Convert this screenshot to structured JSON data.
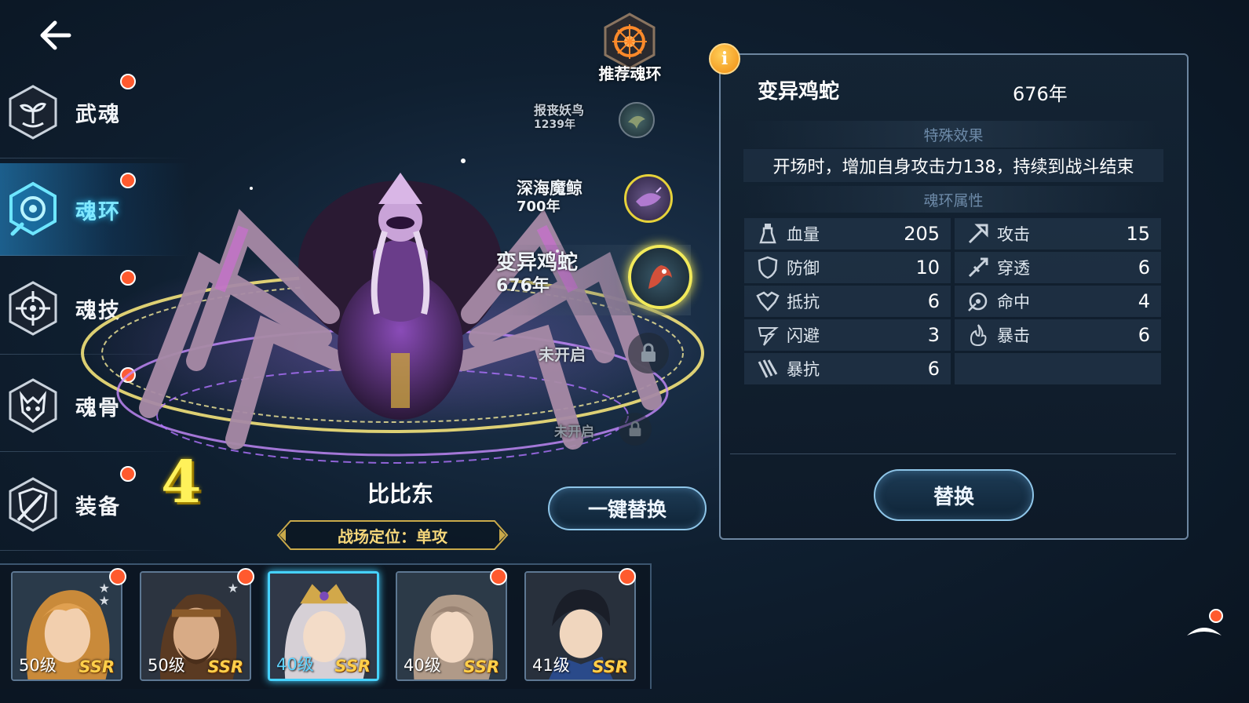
{
  "sidebar": {
    "items": [
      {
        "label": "武魂",
        "has_dot": true
      },
      {
        "label": "魂环",
        "has_dot": true,
        "active": true
      },
      {
        "label": "魂技",
        "has_dot": true
      },
      {
        "label": "魂骨",
        "has_dot": true
      },
      {
        "label": "装备",
        "has_dot": true
      }
    ]
  },
  "recommend": {
    "label": "推荐魂环"
  },
  "rings": [
    {
      "name": "报丧妖鸟",
      "years": "1239年"
    },
    {
      "name": "深海魔鲸",
      "years": "700年"
    },
    {
      "name": "变异鸡蛇",
      "years": "676年"
    },
    {
      "name": "未开启",
      "years": ""
    },
    {
      "name": "未开启",
      "years": ""
    }
  ],
  "stage": {
    "hero_name": "比比东",
    "position_label": "战场定位：单攻",
    "ring_count": "4",
    "oneclick_label": "一键替换"
  },
  "panel": {
    "info_icon": "i",
    "ring_name": "变异鸡蛇",
    "ring_years": "676年",
    "effect_header": "特殊效果",
    "effect_text": "开场时，增加自身攻击力138，持续到战斗结束",
    "attr_header": "魂环属性",
    "stats": [
      {
        "name": "血量",
        "value": "205",
        "icon": "potion-icon"
      },
      {
        "name": "攻击",
        "value": "15",
        "icon": "sword-icon"
      },
      {
        "name": "防御",
        "value": "10",
        "icon": "shield-icon"
      },
      {
        "name": "穿透",
        "value": "6",
        "icon": "pierce-icon"
      },
      {
        "name": "抵抗",
        "value": "6",
        "icon": "armor-icon"
      },
      {
        "name": "命中",
        "value": "4",
        "icon": "target-icon"
      },
      {
        "name": "闪避",
        "value": "3",
        "icon": "dodge-icon"
      },
      {
        "name": "暴击",
        "value": "6",
        "icon": "flame-icon"
      },
      {
        "name": "暴抗",
        "value": "6",
        "icon": "claw-icon"
      }
    ],
    "replace_label": "替换"
  },
  "heroes": [
    {
      "level": "50级",
      "rarity": "SSR",
      "stars": 2,
      "dot": true
    },
    {
      "level": "50级",
      "rarity": "SSR",
      "stars": 1,
      "dot": true
    },
    {
      "level": "40级",
      "rarity": "SSR",
      "stars": 0,
      "dot": false,
      "selected": true
    },
    {
      "level": "40级",
      "rarity": "SSR",
      "stars": 0,
      "dot": true
    },
    {
      "level": "41级",
      "rarity": "SSR",
      "stars": 0,
      "dot": true
    }
  ],
  "colors": {
    "accent": "#46d2ff",
    "dot": "#ff5a2e",
    "gold": "#ffcf4a",
    "panel_border": "#6d86a0"
  }
}
